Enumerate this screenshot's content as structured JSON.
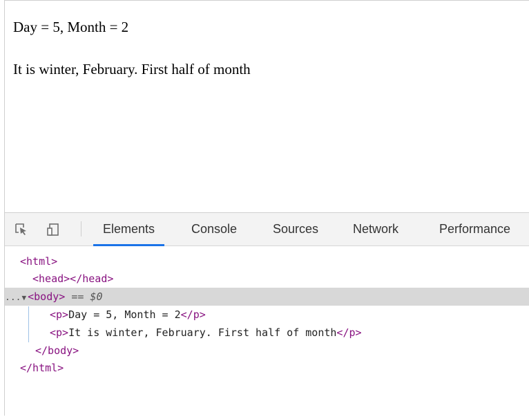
{
  "page": {
    "line1": "Day = 5, Month = 2",
    "line2": "It is winter, February. First half of month"
  },
  "devtools": {
    "tabs": [
      "Elements",
      "Console",
      "Sources",
      "Network",
      "Performance"
    ],
    "active_tab": "Elements",
    "icons": [
      "inspect-element-icon",
      "device-toolbar-icon"
    ],
    "accent_color": "#1a73e8",
    "tag_color": "#881280",
    "dom_tree": {
      "html_open": "<html>",
      "head": "<head></head>",
      "body_prefix": "...",
      "body_open": "<body>",
      "body_selected_marker": "== $0",
      "p_open": "<p>",
      "p_close": "</p>",
      "p1_text": "Day = 5, Month = 2",
      "p2_text": "It is winter, February. First half of month",
      "body_close": "</body>",
      "html_close": "</html>"
    }
  }
}
